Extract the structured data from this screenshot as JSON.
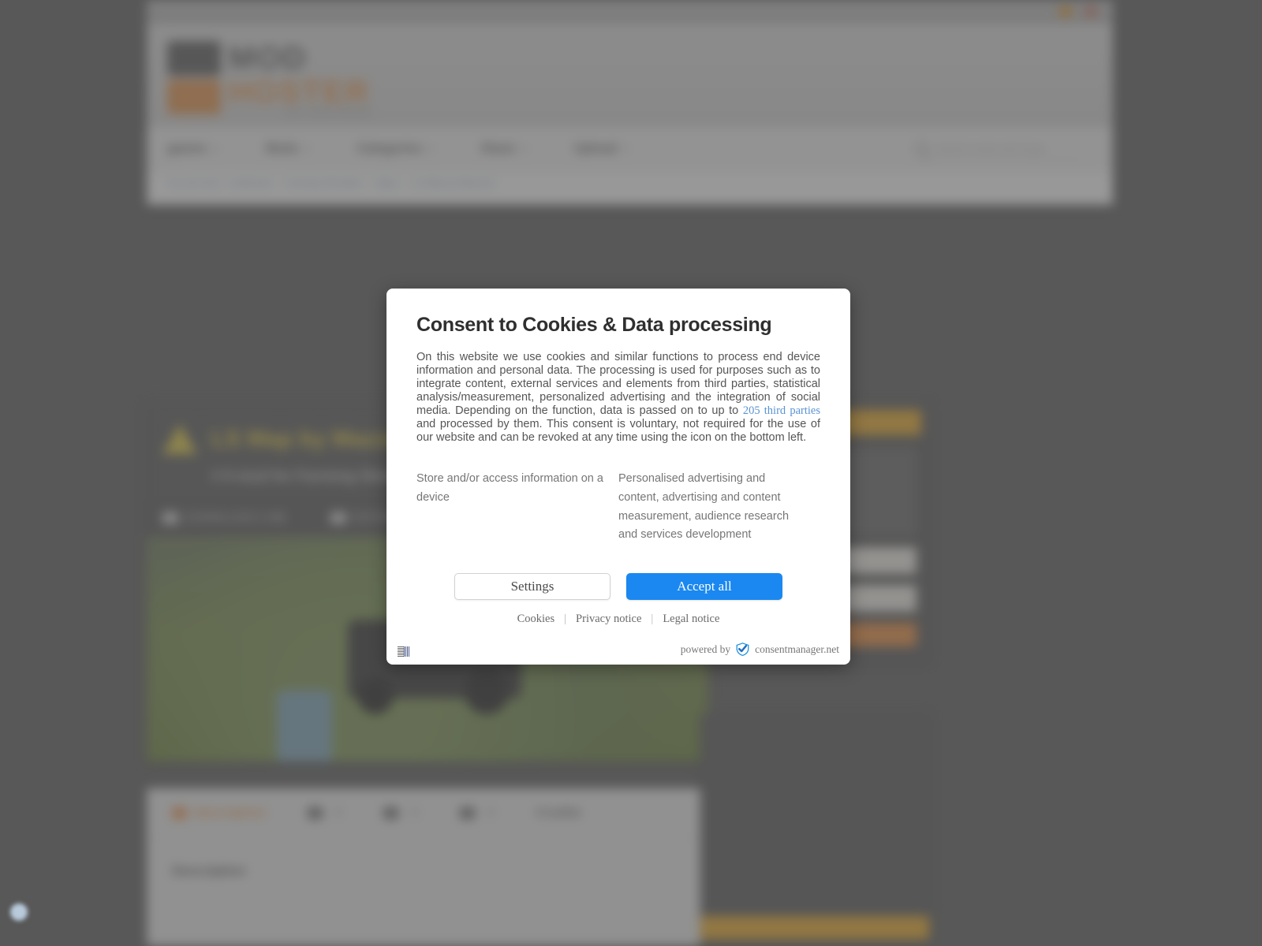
{
  "overlay": {
    "dim_color": "#464646",
    "revoke_icon": "cookie-revoke-icon"
  },
  "browser": {
    "badges": [
      "extension-badge-orange",
      "extension-badge-red"
    ]
  },
  "site": {
    "logo": {
      "primary": "MOD",
      "secondary": "HOSTER",
      "tagline": "your mods hosting"
    },
    "nav": [
      {
        "label": "games",
        "caret": "▾"
      },
      {
        "label": "Mods",
        "caret": "▾"
      },
      {
        "label": "Categories",
        "caret": "▾"
      },
      {
        "label": "Share",
        "caret": "▾"
      },
      {
        "label": "Upload",
        "caret": "▾"
      }
    ],
    "search": {
      "placeholder": "Search mods and maps",
      "icon": "search-icon"
    },
    "breadcrumb": [
      "You are here:",
      "modhoster",
      "Farming Simulator",
      "Maps",
      "LS Map by Mazzelo"
    ],
    "mod": {
      "warning_icon": "warning-triangle-icon",
      "title": "LS Map by Mazzelo",
      "subtitle": "# 0 mod for Farming Simulator",
      "stats": [
        {
          "icon": "download-icon",
          "label": "DOWNLOAD 0 MB"
        },
        {
          "icon": "rating-icon",
          "label": "RATING"
        }
      ]
    },
    "tabs": [
      {
        "label": "description",
        "icon": "description-icon",
        "count": "",
        "active": true
      },
      {
        "label": "",
        "icon": "images-icon",
        "count": "0",
        "active": false
      },
      {
        "label": "",
        "icon": "video-icon",
        "count": "0",
        "active": false
      },
      {
        "label": "",
        "icon": "comments-icon",
        "count": "0",
        "active": false
      },
      {
        "label": "Credits",
        "icon": "",
        "count": "",
        "active": false
      }
    ],
    "description_heading": "Description",
    "sidebar": {
      "banner_label": "Download",
      "button_label": "DOWNLOAD NOW",
      "accent_orange": "#ef9b55",
      "accent_yellow": "#eeb440"
    }
  },
  "dialog": {
    "title": "Consent to Cookies & Data processing",
    "body_before_link": "On this website we use cookies and similar functions to process end device information and personal data. The processing is used for purposes such as to integrate content, external services and elements from third parties, statistical analysis/measurement, personalized advertising and the integration of social media. Depending on the function, data is passed on to up to ",
    "link_text": "205 third parties",
    "body_after_link": " and processed by them. This consent is voluntary, not required for the use of our website and can be revoked at any time using the icon on the bottom left.",
    "purposes": [
      "Store and/or access information on a device",
      "Personalised advertising and content, advertising and content measurement, audience research and services development"
    ],
    "buttons": {
      "settings": "Settings",
      "accept_all": "Accept all"
    },
    "links": [
      "Cookies",
      "Privacy notice",
      "Legal notice"
    ],
    "link_separator": "|",
    "footer": {
      "language_icon": "language-flags-icon",
      "powered_by": "powered by",
      "brand": "consentmanager.net",
      "brand_icon": "consentmanager-shield-check-icon"
    },
    "colors": {
      "accept_blue": "#1a88f0",
      "link_blue": "#5a93d4",
      "title_gray": "#2f2f2f",
      "body_gray": "#555555"
    }
  }
}
